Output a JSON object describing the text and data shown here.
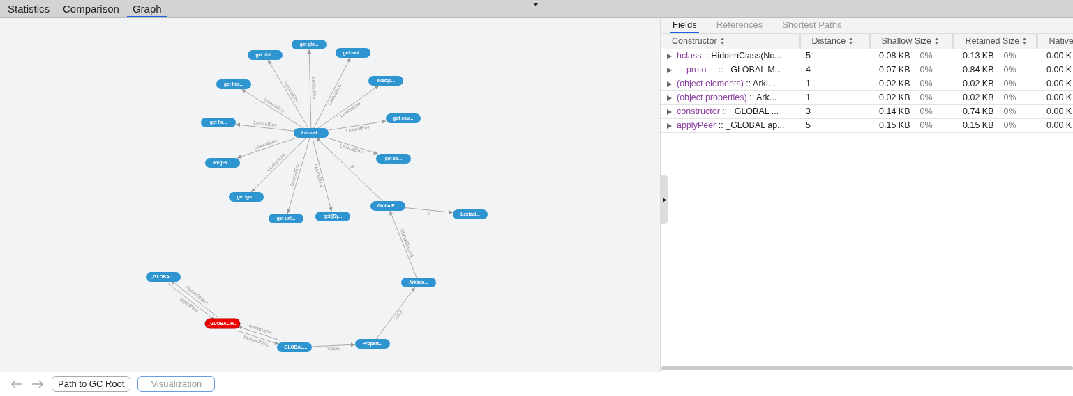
{
  "top_tabs": [
    {
      "label": "Statistics",
      "selected": false
    },
    {
      "label": "Comparison",
      "selected": false
    },
    {
      "label": "Graph",
      "selected": true
    }
  ],
  "graph": {
    "nodes": [
      {
        "label": "Lexical...",
        "selected": false
      },
      {
        "label": "get glo...",
        "selected": false
      },
      {
        "label": "get dot...",
        "selected": false
      },
      {
        "label": "get mul...",
        "selected": false
      },
      {
        "label": "exec@...",
        "selected": false
      },
      {
        "label": "get has...",
        "selected": false
      },
      {
        "label": "get sou...",
        "selected": false
      },
      {
        "label": "get fla...",
        "selected": false
      },
      {
        "label": "get stl...",
        "selected": false
      },
      {
        "label": "RegEx...",
        "selected": false
      },
      {
        "label": "get ign...",
        "selected": false
      },
      {
        "label": "get uni...",
        "selected": false
      },
      {
        "label": "get [Sy...",
        "selected": false
      },
      {
        "label": "GlobalE...",
        "selected": false
      },
      {
        "label": "Lexical...",
        "selected": false
      },
      {
        "label": "_GLOBAL...",
        "selected": false
      },
      {
        "label": "ArkInte...",
        "selected": false
      },
      {
        "label": "_GLOBAL H...",
        "selected": true
      },
      {
        "label": "_GLOBAL...",
        "selected": false
      },
      {
        "label": "Propert...",
        "selected": false
      }
    ],
    "edges": [
      {
        "label": "LexicalEnv"
      },
      {
        "label": "LexicalEnv"
      },
      {
        "label": "LexicalEnv"
      },
      {
        "label": "LexicalEnv"
      },
      {
        "label": "LexicalEnv"
      },
      {
        "label": "LexicalEnv"
      },
      {
        "label": "LexicalEnv"
      },
      {
        "label": "LexicalEnv"
      },
      {
        "label": "LexicalEnv"
      },
      {
        "label": "LexicalEnv"
      },
      {
        "label": "LexicalEnv"
      },
      {
        "label": "LexicalEnv"
      },
      {
        "label": "0"
      },
      {
        "label": "0"
      },
      {
        "label": "GlobalRecord"
      },
      {
        "label": "3118"
      },
      {
        "label": "Value"
      },
      {
        "label": "constructor"
      },
      {
        "label": "HomeObject"
      },
      {
        "label": "HomeObject"
      },
      {
        "label": "applyPeer"
      }
    ]
  },
  "detail_tabs": [
    {
      "label": "Fields",
      "selected": true
    },
    {
      "label": "References",
      "selected": false
    },
    {
      "label": "Shortest Paths",
      "selected": false
    }
  ],
  "table": {
    "columns": [
      "Constructor",
      "Distance",
      "Shallow Size",
      "Retained Size",
      "Native"
    ],
    "rows": [
      {
        "field": "hclass",
        "type": ":: HiddenClass(No...",
        "distance": "5",
        "shallow": "0.08 KB",
        "shallow_pct": "0%",
        "retained": "0.13 KB",
        "retained_pct": "0%",
        "native": "0.00 K"
      },
      {
        "field": "__proto__",
        "type": ":: _GLOBAL M...",
        "distance": "4",
        "shallow": "0.07 KB",
        "shallow_pct": "0%",
        "retained": "0.84 KB",
        "retained_pct": "0%",
        "native": "0.00 K"
      },
      {
        "field": "(object elements)",
        "type": ":: ArkI...",
        "distance": "1",
        "shallow": "0.02 KB",
        "shallow_pct": "0%",
        "retained": "0.02 KB",
        "retained_pct": "0%",
        "native": "0.00 K"
      },
      {
        "field": "(object properties)",
        "type": ":: Ark...",
        "distance": "1",
        "shallow": "0.02 KB",
        "shallow_pct": "0%",
        "retained": "0.02 KB",
        "retained_pct": "0%",
        "native": "0.00 K"
      },
      {
        "field": "constructor",
        "type": ":: _GLOBAL ...",
        "distance": "3",
        "shallow": "0.14 KB",
        "shallow_pct": "0%",
        "retained": "0.74 KB",
        "retained_pct": "0%",
        "native": "0.00 K"
      },
      {
        "field": "applyPeer",
        "type": ":: _GLOBAL ap...",
        "distance": "5",
        "shallow": "0.15 KB",
        "shallow_pct": "0%",
        "retained": "0.15 KB",
        "retained_pct": "0%",
        "native": "0.00 K"
      }
    ]
  },
  "bottom_buttons": [
    {
      "label": "Path to GC Root",
      "selected": false
    },
    {
      "label": "Visualization",
      "selected": true
    }
  ]
}
